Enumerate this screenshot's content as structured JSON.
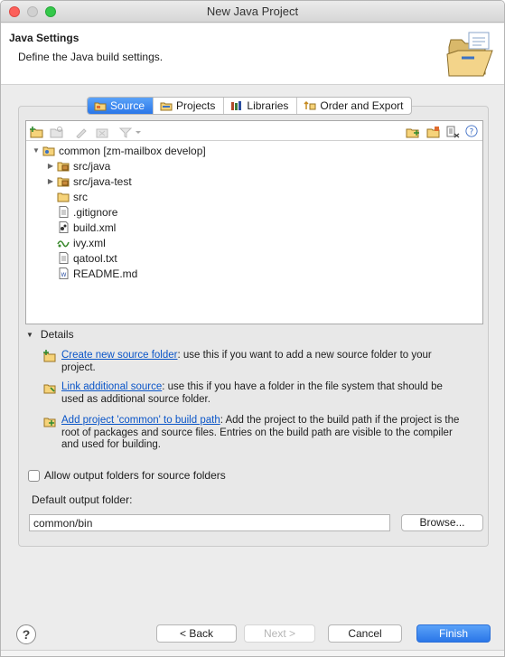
{
  "window": {
    "title": "New Java Project"
  },
  "header": {
    "title": "Java Settings",
    "description": "Define the Java build settings."
  },
  "tabs": [
    {
      "label": "Source",
      "icon": "source-folder-icon",
      "active": true
    },
    {
      "label": "Projects",
      "icon": "projects-icon",
      "active": false
    },
    {
      "label": "Libraries",
      "icon": "libraries-icon",
      "active": false
    },
    {
      "label": "Order and Export",
      "icon": "order-export-icon",
      "active": false
    }
  ],
  "tree": {
    "root": "common [zm-mailbox develop]",
    "items": [
      {
        "label": "src/java",
        "expandable": true,
        "icon": "package-folder-icon"
      },
      {
        "label": "src/java-test",
        "expandable": true,
        "icon": "package-folder-icon"
      },
      {
        "label": "src",
        "expandable": false,
        "icon": "folder-icon"
      },
      {
        "label": ".gitignore",
        "expandable": false,
        "icon": "text-file-icon"
      },
      {
        "label": "build.xml",
        "expandable": false,
        "icon": "ant-file-icon"
      },
      {
        "label": "ivy.xml",
        "expandable": false,
        "icon": "ivy-file-icon"
      },
      {
        "label": "qatool.txt",
        "expandable": false,
        "icon": "text-file-icon"
      },
      {
        "label": "README.md",
        "expandable": false,
        "icon": "markdown-file-icon"
      }
    ]
  },
  "details": {
    "label": "Details",
    "items": [
      {
        "link": "Create new source folder",
        "text": ": use this if you want to add a new source folder to your project."
      },
      {
        "link": "Link additional source",
        "text": ": use this if you have a folder in the file system that should be used as additional source folder."
      },
      {
        "link": "Add project 'common' to build path",
        "text": ": Add the project to the build path if the project is the root of packages and source files. Entries on the build path are visible to the compiler and used for building."
      }
    ]
  },
  "options": {
    "allow_output_label": "Allow output folders for source folders",
    "allow_output_checked": false,
    "default_output_label": "Default output folder:",
    "default_output_value": "common/bin",
    "browse_label": "Browse..."
  },
  "footer": {
    "help_label": "?",
    "back_label": "< Back",
    "next_label": "Next >",
    "cancel_label": "Cancel",
    "finish_label": "Finish"
  },
  "colors": {
    "accent": "#2a76e8",
    "link": "#0a55c8"
  }
}
